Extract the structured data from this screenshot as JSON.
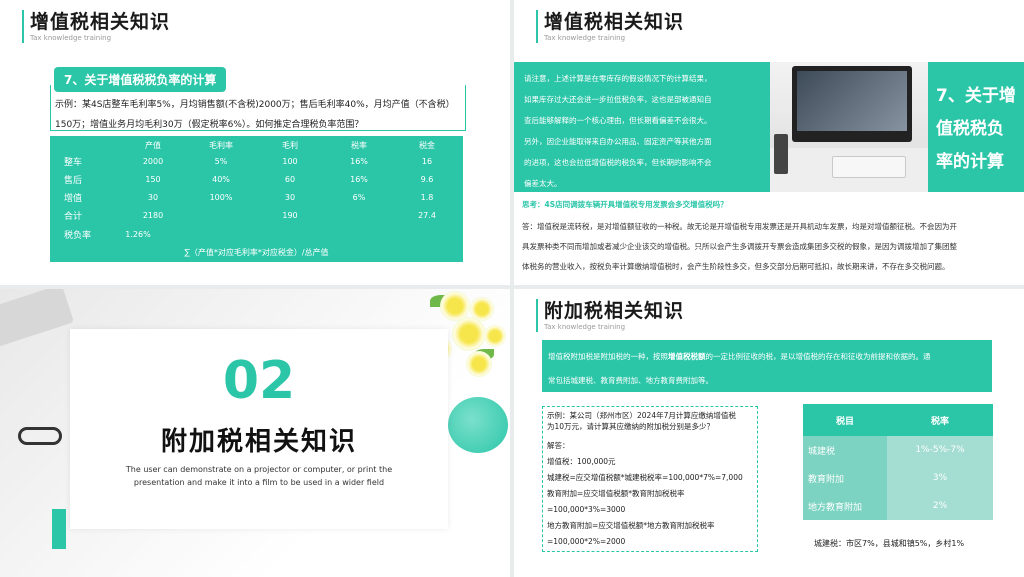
{
  "colors": {
    "accent": "#2bc6a8",
    "light_row": "#a4ddd2",
    "mid_row": "#7cd3c2"
  },
  "slide1": {
    "title": "增值税相关知识",
    "subtitle": "Tax knowledge training",
    "tag": "7、关于增值税税负率的计算",
    "example_line1": "示例：某4S店整车毛利率5%，月均销售额(不含税)2000万；售后毛利率40%，月均产值（不含税）",
    "example_line2": "150万；增值业务月均毛利30万（假定税率6%）。如何推定合理税负率范围？",
    "table": {
      "headers": [
        "产值",
        "毛利率",
        "毛利",
        "税率",
        "税金"
      ],
      "rows": [
        {
          "label": "整车",
          "cells": [
            "2000",
            "5%",
            "100",
            "16%",
            "16"
          ]
        },
        {
          "label": "售后",
          "cells": [
            "150",
            "40%",
            "60",
            "16%",
            "9.6"
          ]
        },
        {
          "label": "增值",
          "cells": [
            "30",
            "100%",
            "30",
            "6%",
            "1.8"
          ]
        },
        {
          "label": "合计",
          "cells": [
            "2180",
            "",
            "190",
            "",
            "27.4"
          ]
        },
        {
          "label": "税负率",
          "cells": [
            "1.26%",
            "",
            "",
            "",
            ""
          ]
        }
      ],
      "formula": "∑（产值*对应毛利率*对应税金）/总产值"
    }
  },
  "slide2": {
    "title": "增值税相关知识",
    "subtitle": "Tax knowledge training",
    "notice_lines": [
      "请注意，上述计算是在零库存的假设情况下的计算结果，",
      "如果库存过大还会进一步拉低税负率，这也是部被通知自",
      "查后能够解释的一个核心理由，但长期看偏差不会很大。",
      "另外，因企业能取得来自办公用品、固定资产等其他方面",
      "的进项，这也会拉低增值税的税负率，但长期的影响不会",
      "偏差太大。"
    ],
    "side_title": "7、关于增值税税负率的计算",
    "question": "思考：4S店同调拨车辆开具增值税专用发票会多交增值税吗？",
    "answer_lines": [
      "答：增值税是流转税，是对增值额征收的一种税。故无论是开增值税专用发票还是开具机动车发票，均是对增值额征税。不会因为开",
      "具发票种类不同而增加或者减少企业该交的增值税。只所以会产生多调拨开专票会造成集团多交税的假象，是因为调拨增加了集团整",
      "体税务的营业收入，按税负率计算缴纳增值税时，会产生阶段性多交，但多交部分后期可抵扣，故长期来讲，不存在多交税问题。"
    ]
  },
  "slide3": {
    "number": "02",
    "title": "附加税相关知识",
    "desc_line1": "The user can demonstrate on a projector or computer, or print the",
    "desc_line2": "presentation and make it into a film to be used in a wider field"
  },
  "slide4": {
    "title": "附加税相关知识",
    "subtitle": "Tax knowledge training",
    "intro_pre": "增值税附加税是附加税的一种，按照",
    "intro_highlight": "增值税税额",
    "intro_post": "的一定比例征收的税，是以增值税的存在和征收为前提和依据的。通",
    "intro_line2": "常包括城建税、教育费附加、地方教育费附加等。",
    "example_lines": [
      "示例：某公司（郑州市区）2024年7月计算应缴纳增值税",
      "为10万元，请计算其应缴纳的附加税分别是多少？",
      "",
      "解答：",
      "增值税：100,000元",
      "城建税=应交增值税额*城建税税率=100,000*7%=7,000",
      "教育附加=应交增值税额*教育附加税税率",
      "=100,000*3%=3000",
      "地方教育附加=应交增值税额*地方教育附加税税率",
      "=100,000*2%=2000"
    ],
    "rate_table": {
      "headers": [
        "税目",
        "税率"
      ],
      "rows": [
        {
          "item": "城建税",
          "rate": "1%-5%-7%"
        },
        {
          "item": "教育附加",
          "rate": "3%"
        },
        {
          "item": "地方教育附加",
          "rate": "2%"
        }
      ]
    },
    "note": "城建税：市区7%，县城和镇5%，乡村1%"
  }
}
